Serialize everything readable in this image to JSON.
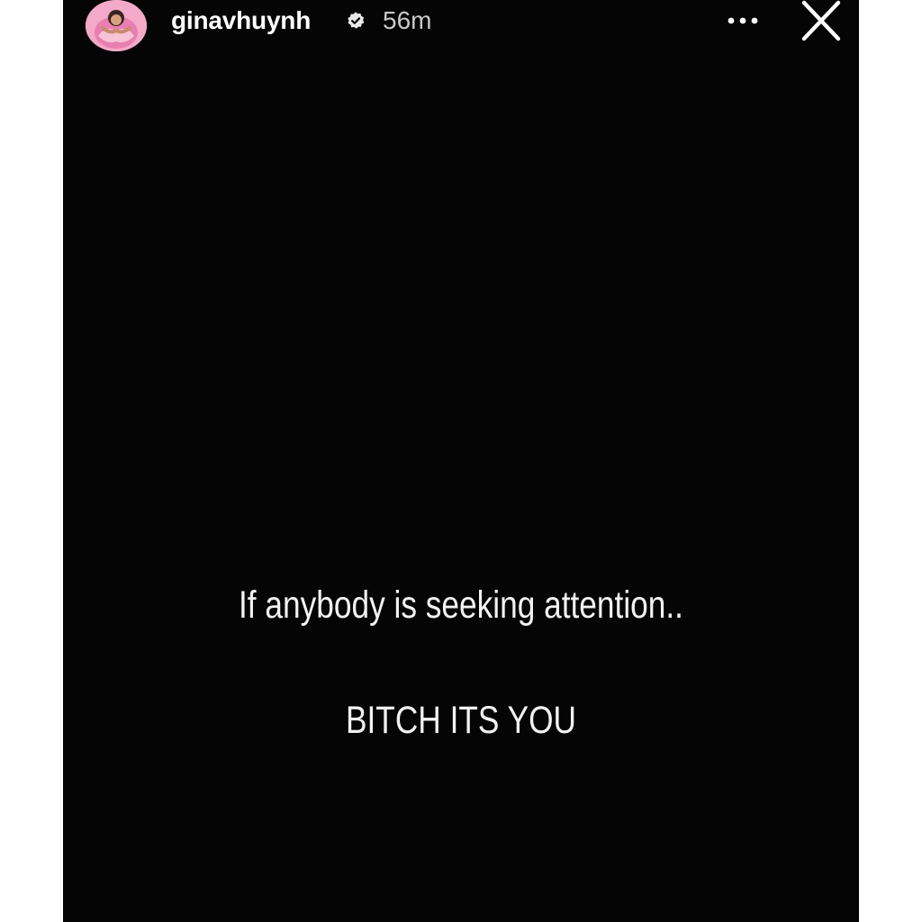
{
  "story": {
    "username": "ginavhuynh",
    "verified": true,
    "timestamp": "56m",
    "avatar_icon": "profile-avatar",
    "verified_icon": "verified-badge-icon",
    "more_icon": "more-options-icon",
    "close_icon": "close-icon",
    "background_color": "#050505",
    "text_color": "#ffffff"
  },
  "content": {
    "line1": "If anybody is seeking attention..",
    "line2": "BITCH ITS YOU"
  }
}
